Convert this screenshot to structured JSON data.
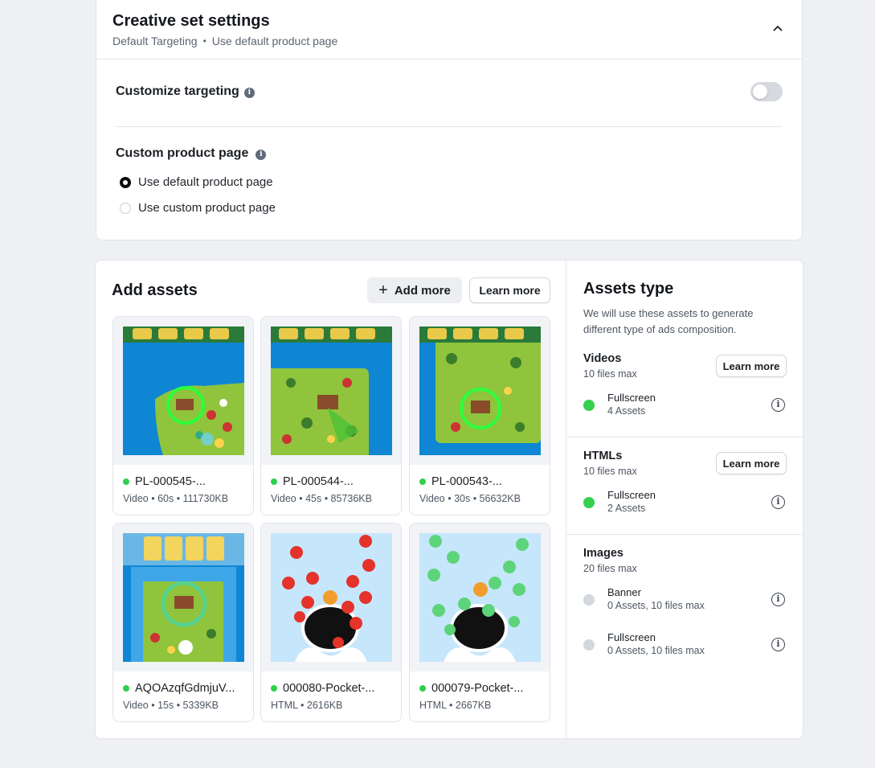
{
  "settings": {
    "title": "Creative set settings",
    "subtitle_left": "Default Targeting",
    "subtitle_sep": "•",
    "subtitle_right": "Use default product page",
    "customize_targeting": {
      "label": "Customize targeting",
      "enabled": false
    },
    "custom_product_page": {
      "label": "Custom product page",
      "options": [
        {
          "label": "Use default product page",
          "selected": true
        },
        {
          "label": "Use custom product page",
          "selected": false
        }
      ]
    }
  },
  "assets": {
    "title": "Add assets",
    "add_more_label": "Add more",
    "learn_more_label": "Learn more",
    "tiles": [
      {
        "name": "PL-000545-...",
        "meta": "Video • 60s • 111730KB",
        "status_color": "#2ed04a"
      },
      {
        "name": "PL-000544-...",
        "meta": "Video • 45s • 85736KB",
        "status_color": "#2ed04a"
      },
      {
        "name": "PL-000543-...",
        "meta": "Video • 30s • 56632KB",
        "status_color": "#2ed04a"
      },
      {
        "name": "AQOAzqfGdmjuV...",
        "meta": "Video • 15s • 5339KB",
        "status_color": "#2ed04a"
      },
      {
        "name": "000080-Pocket-...",
        "meta": "HTML • 2616KB",
        "status_color": "#2ed04a"
      },
      {
        "name": "000079-Pocket-...",
        "meta": "HTML • 2667KB",
        "status_color": "#2ed04a"
      }
    ]
  },
  "assets_type": {
    "title": "Assets type",
    "description": "We will use these assets to generate different type of ads composition.",
    "sections": [
      {
        "title": "Videos",
        "subtitle": "10 files max",
        "learn_more_label": "Learn more",
        "items": [
          {
            "name": "Fullscreen",
            "count": "4 Assets",
            "status": "active"
          }
        ]
      },
      {
        "title": "HTMLs",
        "subtitle": "10 files max",
        "learn_more_label": "Learn more",
        "items": [
          {
            "name": "Fullscreen",
            "count": "2 Assets",
            "status": "active"
          }
        ]
      },
      {
        "title": "Images",
        "subtitle": "20 files max",
        "items": [
          {
            "name": "Banner",
            "count": "0 Assets, 10 files max",
            "status": "inactive"
          },
          {
            "name": "Fullscreen",
            "count": "0 Assets, 10 files max",
            "status": "inactive"
          }
        ]
      }
    ]
  },
  "icons": {
    "collapse": "chevron-up-icon",
    "info": "info-icon",
    "add": "plus-icon"
  }
}
